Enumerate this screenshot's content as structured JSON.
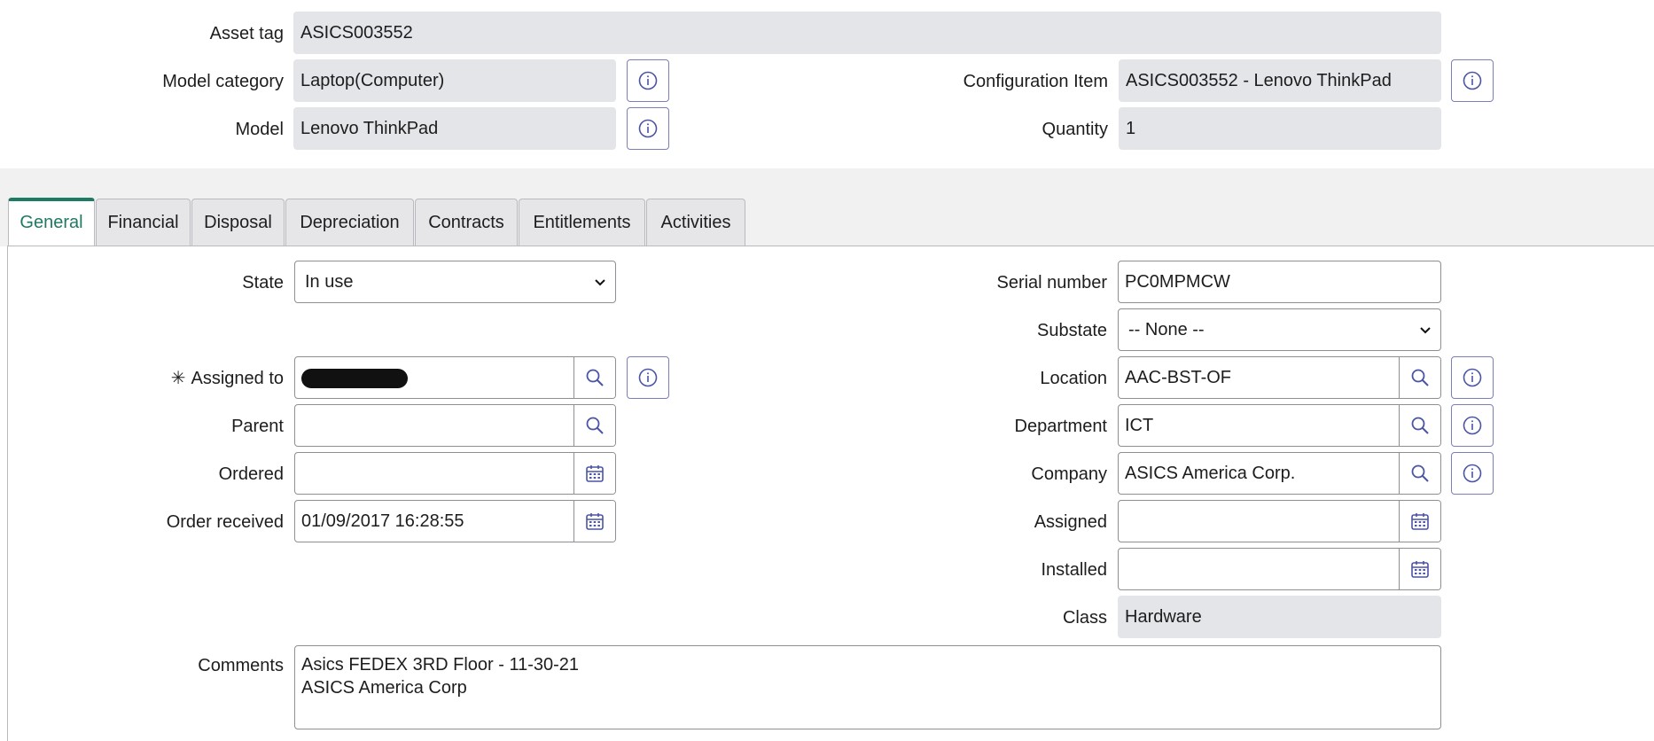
{
  "header": {
    "asset_tag": {
      "label": "Asset tag",
      "value": "ASICS003552"
    },
    "model_category": {
      "label": "Model category",
      "value": "Laptop(Computer)"
    },
    "model": {
      "label": "Model",
      "value": "Lenovo  ThinkPad"
    },
    "configuration_item": {
      "label": "Configuration Item",
      "value": "ASICS003552 - Lenovo  ThinkPad"
    },
    "quantity": {
      "label": "Quantity",
      "value": "1"
    }
  },
  "tabs": [
    {
      "label": "General",
      "active": true
    },
    {
      "label": "Financial"
    },
    {
      "label": "Disposal"
    },
    {
      "label": "Depreciation"
    },
    {
      "label": "Contracts"
    },
    {
      "label": "Entitlements"
    },
    {
      "label": "Activities"
    }
  ],
  "general": {
    "state": {
      "label": "State",
      "value": "In use"
    },
    "assigned_to": {
      "label": "Assigned to",
      "required_mark": "✳",
      "value": "[redacted]"
    },
    "parent": {
      "label": "Parent",
      "value": ""
    },
    "ordered": {
      "label": "Ordered",
      "value": ""
    },
    "order_received": {
      "label": "Order received",
      "value": "01/09/2017 16:28:55"
    },
    "serial_number": {
      "label": "Serial number",
      "value": "PC0MPMCW"
    },
    "substate": {
      "label": "Substate",
      "value": "-- None --"
    },
    "location": {
      "label": "Location",
      "value": "AAC-BST-OF"
    },
    "department": {
      "label": "Department",
      "value": "ICT"
    },
    "company": {
      "label": "Company",
      "value": "ASICS America Corp."
    },
    "assigned": {
      "label": "Assigned",
      "value": ""
    },
    "installed": {
      "label": "Installed",
      "value": ""
    },
    "class": {
      "label": "Class",
      "value": "Hardware"
    },
    "comments": {
      "label": "Comments",
      "line1": "Asics FEDEX 3RD Floor  - 11-30-21",
      "line2": "ASICS America Corp"
    }
  },
  "icons": {
    "info": "info-icon",
    "search": "search-icon",
    "calendar": "calendar-icon",
    "chevron": "chevron-down-icon"
  },
  "colors": {
    "accent": "#1e7a63",
    "readonly_bg": "#e4e5e8",
    "icon": "#4a54a6",
    "band": "#f1f1f1"
  }
}
